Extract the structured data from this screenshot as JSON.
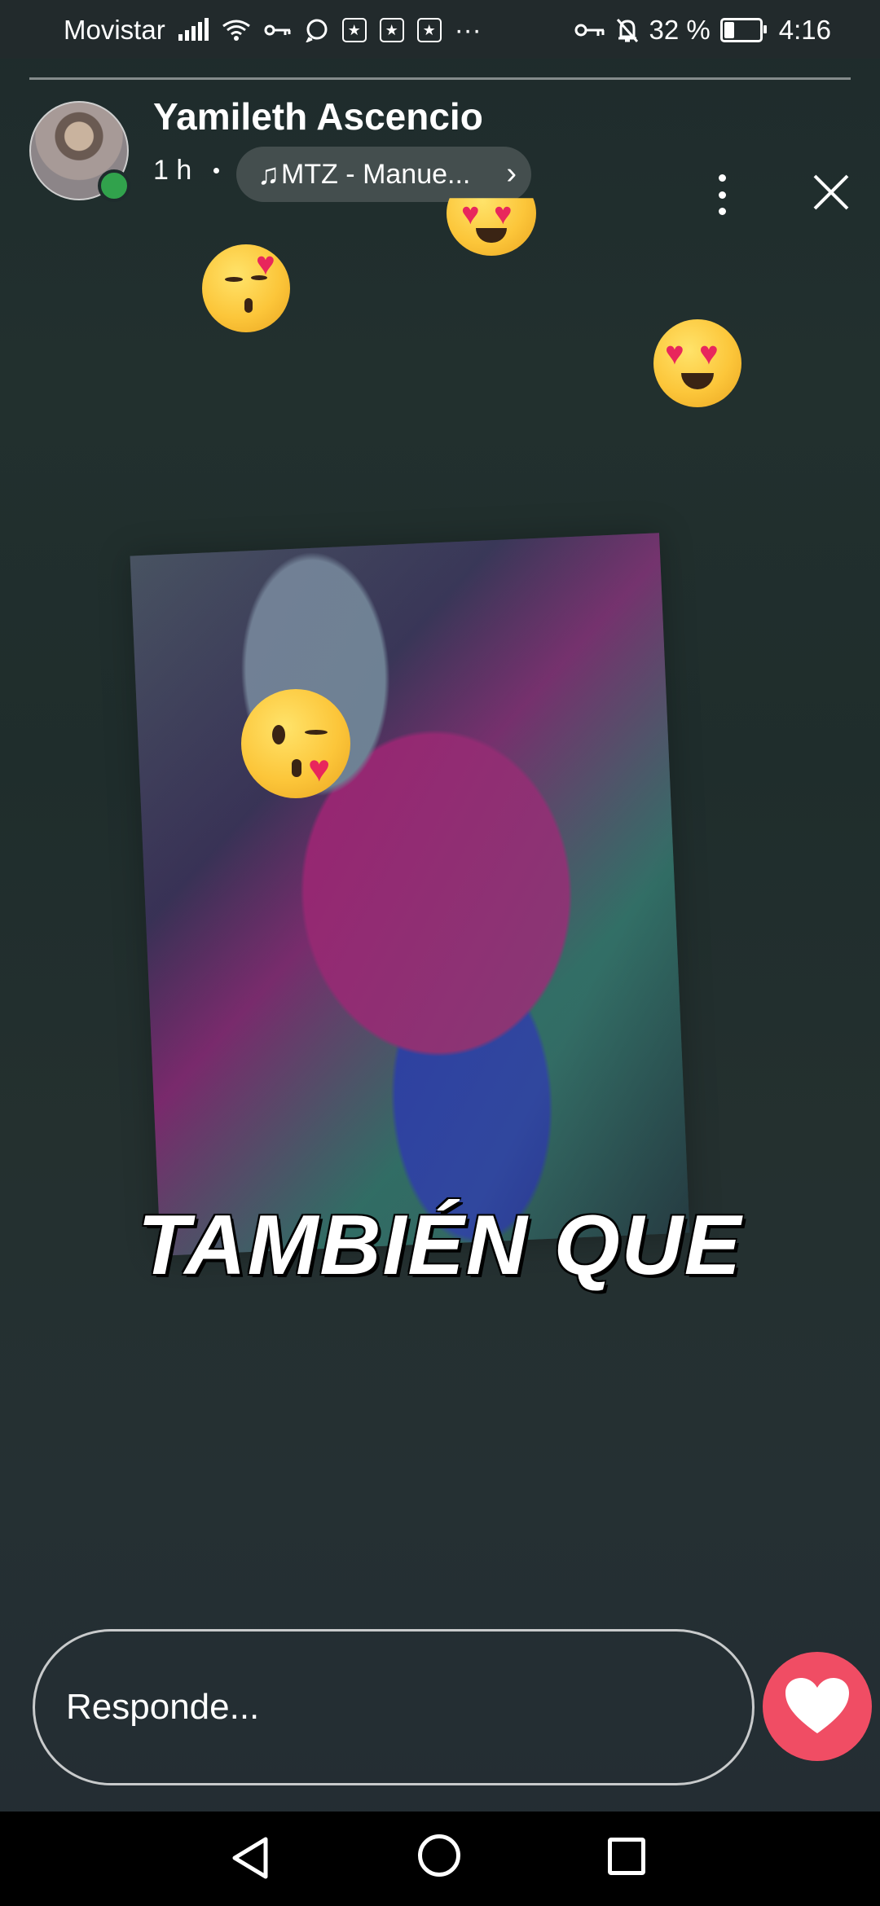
{
  "status_bar": {
    "carrier": "Movistar",
    "more": "···",
    "battery_percent": "32 %",
    "battery_level": 0.32,
    "time": "4:16",
    "icons": [
      "signal-icon",
      "wifi-icon",
      "vpn-key-icon",
      "whatsapp-icon",
      "star-box-icon",
      "star-box-icon",
      "star-box-icon",
      "key-icon",
      "bell-off-icon",
      "battery-icon"
    ]
  },
  "story": {
    "progress": 0.0,
    "user_name": "Yamileth Ascencio",
    "time_ago": "1 h",
    "music": {
      "note": "♫",
      "label": "MTZ - Manue..."
    },
    "overlay_text": "TAMBIÉN QUE",
    "stickers": [
      "heart-eyes-emoji",
      "kissing-emoji",
      "heart-eyes-emoji",
      "kiss-wink-emoji"
    ]
  },
  "reply": {
    "placeholder": "Responde...",
    "like_icon": "heart-icon",
    "like_color": "#f04d64"
  },
  "navigation": {
    "icons": [
      "back-icon",
      "home-icon",
      "recents-icon"
    ]
  },
  "colors": {
    "online": "#31a24c",
    "background": "#1f2a2e"
  }
}
